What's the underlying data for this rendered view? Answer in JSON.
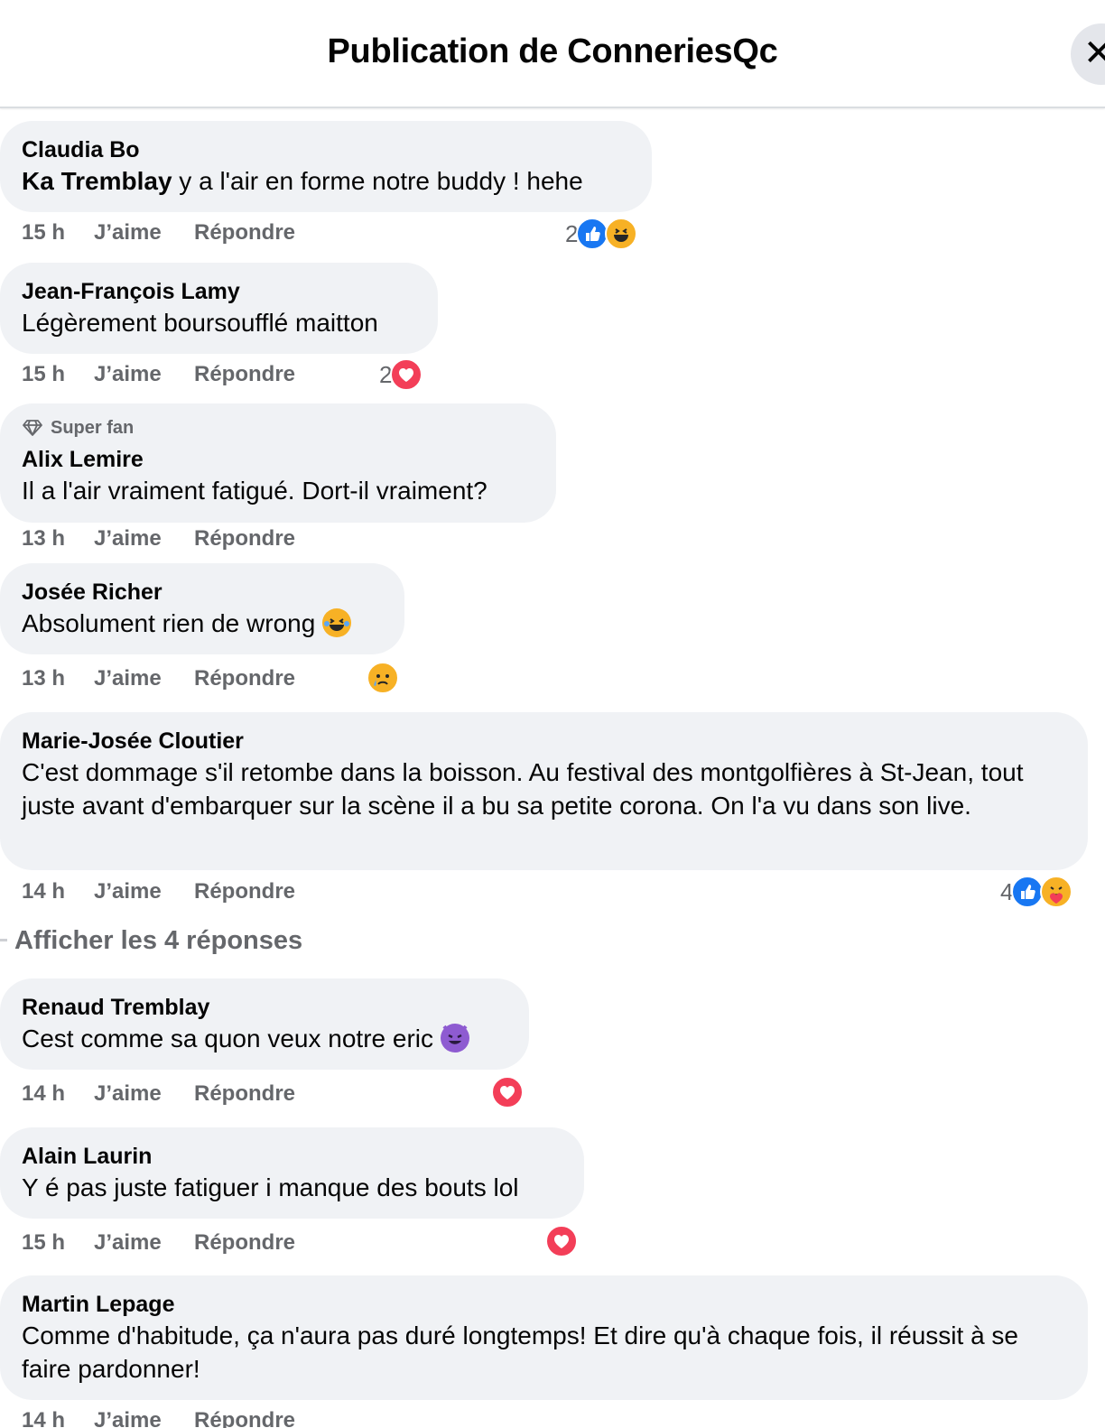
{
  "header": {
    "title": "Publication de ConneriesQc",
    "close_label": "✕"
  },
  "comments": [
    {
      "author": "Claudia Bo",
      "mention": "Ka Tremblay",
      "text": " y a l'air en forme notre buddy ! hehe",
      "time": "15 h",
      "like": "J’aime",
      "reply": "Répondre",
      "reaction_count": "2",
      "reactions": [
        "like-icon",
        "haha-icon"
      ]
    },
    {
      "author": "Jean-François Lamy",
      "text": "Légèrement boursoufflé maitton",
      "time": "15 h",
      "like": "J’aime",
      "reply": "Répondre",
      "reaction_count": "2",
      "reactions": [
        "love-icon"
      ]
    },
    {
      "badge": "Super fan",
      "author": "Alix Lemire",
      "text": "Il a l'air vraiment fatigué. Dort-il vraiment?",
      "time": "13 h",
      "like": "J’aime",
      "reply": "Répondre"
    },
    {
      "author": "Josée Richer",
      "text": "Absolument rien de wrong ",
      "emoji": "laughing-tears-emoji",
      "time": "13 h",
      "like": "J’aime",
      "reply": "Répondre",
      "reactions": [
        "sad-icon"
      ]
    },
    {
      "author": "Marie-Josée Cloutier",
      "text": "C'est dommage s'il retombe dans la boisson. Au festival des montgolfières à St-Jean, tout juste avant d'embarquer sur la scène il a bu sa petite corona. On l'a vu dans son live.",
      "time": "14 h",
      "like": "J’aime",
      "reply": "Répondre",
      "reaction_count": "4",
      "reactions": [
        "like-icon",
        "care-icon"
      ]
    },
    {
      "author": "Renaud Tremblay",
      "text": "Cest comme sa quon veux notre eric ",
      "emoji": "devil-emoji",
      "time": "14 h",
      "like": "J’aime",
      "reply": "Répondre",
      "reactions": [
        "love-icon"
      ]
    },
    {
      "author": "Alain Laurin",
      "text": "Y é pas juste fatiguer i manque des bouts lol",
      "time": "15 h",
      "like": "J’aime",
      "reply": "Répondre",
      "reactions": [
        "love-icon"
      ]
    },
    {
      "author": "Martin Lepage",
      "text": "Comme d'habitude, ça n'aura pas duré longtemps! Et dire qu'à chaque fois, il réussit à se faire pardonner!",
      "time": "14 h",
      "like": "J’aime",
      "reply": "Répondre"
    }
  ],
  "show_replies": "Afficher les 4 réponses",
  "colors": {
    "like": "#1877f2",
    "love": "#f33e58",
    "emoji": "#f7b125",
    "bubble": "#f0f2f5",
    "meta": "#65676b"
  }
}
